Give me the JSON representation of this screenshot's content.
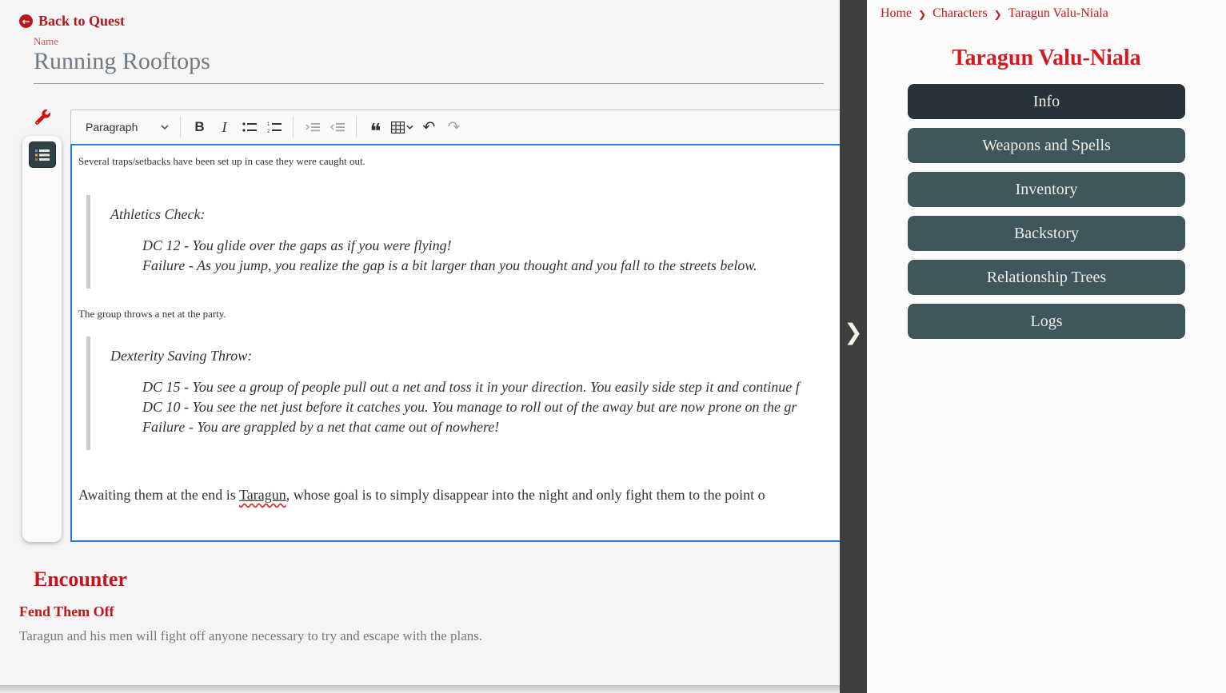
{
  "quest_editor": {
    "back_link_label": "Back to Quest",
    "back_icon_glyph": "←",
    "name_label": "Name",
    "name_value": "Running Rooftops",
    "toolbar": {
      "paragraph_dropdown": "Paragraph",
      "bold_label": "B",
      "italic_label": "I",
      "quote_glyph": "❝",
      "undo_glyph": "↶",
      "redo_glyph": "↷",
      "icons": [
        "heading-dropdown",
        "bold-icon",
        "italic-icon",
        "bulleted-list-icon",
        "numbered-list-icon",
        "indent-icon",
        "outdent-icon",
        "block-quote-icon",
        "insert-table-icon",
        "undo-icon",
        "redo-icon"
      ]
    },
    "content": {
      "p1": "Several traps/setbacks have been set up in case they were caught out.",
      "quote1_title": "Athletics Check:",
      "quote1_lines": [
        "DC 12 - You glide over the gaps as if you were flying!",
        "Failure - As you jump, you realize the gap is a bit larger than you thought and you fall to the streets below."
      ],
      "p2": "The group throws a net at the party.",
      "quote2_title": "Dexterity Saving Throw:",
      "quote2_lines": [
        "DC 15 - You see a group of people pull out a net and toss it in your direction. You easily side step it and continue f",
        "DC 10 - You see the net just before it catches you. You manage to roll out of the away but are now prone on the gr",
        "Failure - You are grappled by a net that came out of nowhere!"
      ],
      "p3_before": "Awaiting them at the end is ",
      "p3_misspelled_word": "Taragun",
      "p3_after": ", whose goal is to simply disappear into the night and only fight them to the point o"
    },
    "encounter_heading": "Encounter",
    "encounter_name": "Fend Them Off",
    "encounter_desc": "Taragun and his men will fight off anyone necessary to try and escape with the plans."
  },
  "divider": {
    "collapse_glyph": "❯"
  },
  "sidebar": {
    "breadcrumb": [
      {
        "label": "Home"
      },
      {
        "label": "Characters"
      },
      {
        "label": "Taragun Valu-Niala"
      }
    ],
    "breadcrumb_separator": "❯",
    "title": "Taragun Valu-Niala",
    "nav_buttons": [
      {
        "label": "Info",
        "active": true
      },
      {
        "label": "Weapons and Spells",
        "active": false
      },
      {
        "label": "Inventory",
        "active": false
      },
      {
        "label": "Backstory",
        "active": false
      },
      {
        "label": "Relationship Trees",
        "active": false
      },
      {
        "label": "Logs",
        "active": false
      }
    ]
  },
  "colors": {
    "accent_red": "#c3161c",
    "title_red": "#d31a1f",
    "nav_button_dark": "#26333a",
    "nav_button": "#3f565d",
    "divider_bar": "#3e3e3e",
    "editor_focus_border": "#2b7cd9",
    "name_text": "#6e7b87"
  }
}
